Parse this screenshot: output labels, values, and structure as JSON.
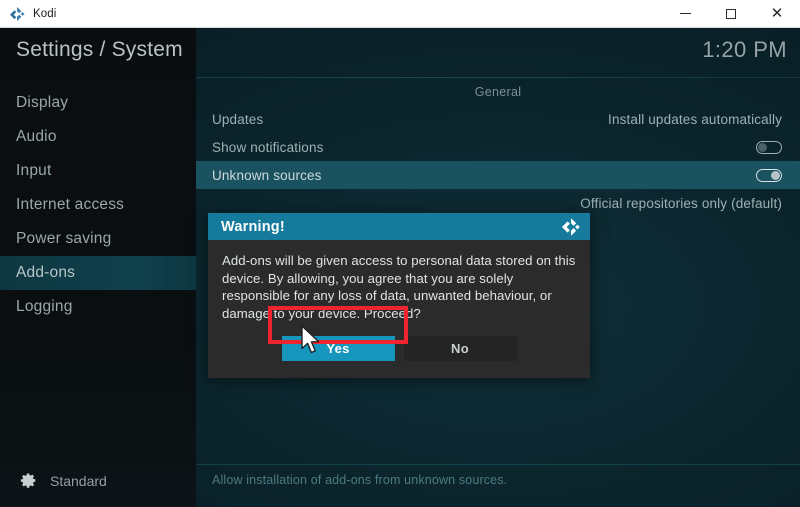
{
  "window": {
    "app_icon": "kodi-logo-icon",
    "title": "Kodi",
    "minimize_label": "–",
    "maximize_label": "□",
    "close_label": "✕"
  },
  "header": {
    "page_title": "Settings / System",
    "clock": "1:20 PM"
  },
  "sidebar": {
    "items": [
      {
        "label": "Display",
        "selected": false
      },
      {
        "label": "Audio",
        "selected": false
      },
      {
        "label": "Input",
        "selected": false
      },
      {
        "label": "Internet access",
        "selected": false
      },
      {
        "label": "Power saving",
        "selected": false
      },
      {
        "label": "Add-ons",
        "selected": true
      },
      {
        "label": "Logging",
        "selected": false
      }
    ],
    "bottom": {
      "icon": "gear-icon",
      "label": "Standard"
    }
  },
  "content": {
    "group_title": "General",
    "rows": [
      {
        "label": "Updates",
        "value": "Install updates automatically",
        "type": "value",
        "selected": false
      },
      {
        "label": "Show notifications",
        "value": "",
        "type": "toggle",
        "toggle_on": false,
        "selected": false
      },
      {
        "label": "Unknown sources",
        "value": "",
        "type": "toggle",
        "toggle_on": true,
        "selected": true
      },
      {
        "label": "",
        "value": "Official repositories only (default)",
        "type": "value",
        "selected": false
      }
    ],
    "description": "Allow installation of add-ons from unknown sources."
  },
  "dialog": {
    "title": "Warning!",
    "logo": "kodi-logo-icon",
    "body": "Add-ons will be given access to personal data stored on this device. By allowing, you agree that you are solely responsible for any loss of data, unwanted behaviour, or damage to your device. Proceed?",
    "confirm_label": "Yes",
    "cancel_label": "No"
  },
  "annotation": {
    "highlight_color": "#ee2430",
    "target": "Yes"
  },
  "colors": {
    "accent_teal": "#1796bd",
    "header_teal": "#157a9b",
    "selected_row": "#1a5260",
    "background": "#0b242c",
    "sidebar": "#0a0e10"
  }
}
